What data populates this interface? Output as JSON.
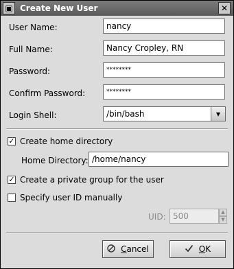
{
  "window": {
    "title": "Create New User",
    "icon": "user-app-icon",
    "close_glyph": "✕"
  },
  "form": {
    "user_name": {
      "label": "User Name:",
      "value": "nancy"
    },
    "full_name": {
      "label": "Full Name:",
      "value": "Nancy Cropley, RN"
    },
    "password": {
      "label": "Password:",
      "value": "********"
    },
    "confirm_password": {
      "label": "Confirm Password:",
      "value": "********"
    },
    "login_shell": {
      "label": "Login Shell:",
      "value": "/bin/bash"
    }
  },
  "options": {
    "create_home": {
      "label": "Create home directory",
      "checked": true
    },
    "home_directory": {
      "label": "Home Directory:",
      "value": "/home/nancy"
    },
    "private_group": {
      "label": "Create a private group for the user",
      "checked": true
    },
    "specify_uid": {
      "label": "Specify user ID manually",
      "checked": false
    },
    "uid": {
      "label": "UID:",
      "value": "500"
    }
  },
  "buttons": {
    "cancel": {
      "prefix": "",
      "mnemonic": "C",
      "rest": "ancel",
      "icon": "cancel-icon"
    },
    "ok": {
      "prefix": "",
      "mnemonic": "O",
      "rest": "K",
      "icon": "ok-check-icon"
    }
  },
  "glyphs": {
    "check": "✓",
    "dropdown": "▾",
    "spin_up": "▲",
    "spin_down": "▼"
  }
}
